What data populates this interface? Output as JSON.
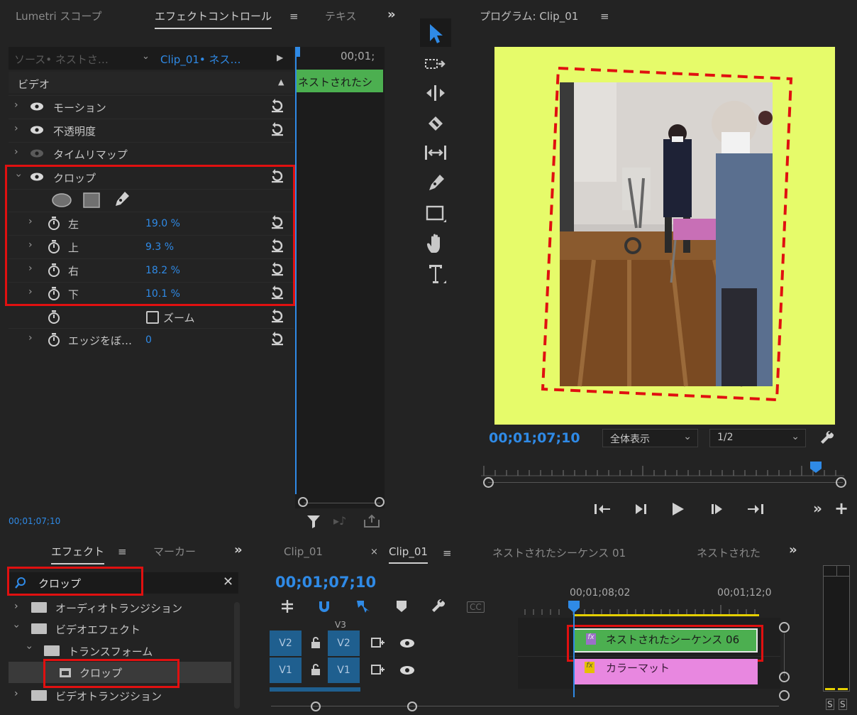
{
  "effect_controls": {
    "tabs": [
      "Lumetri スコープ",
      "エフェクトコントロール",
      "テキス"
    ],
    "source_label": "ソース• ネストさ…",
    "clip_label": "Clip_01• ネス…",
    "mini_timecode": "00;01;",
    "mini_clip": "ネストされたシ",
    "section": "ビデオ",
    "effects": [
      "モーション",
      "不透明度",
      "タイムリマップ",
      "クロップ"
    ],
    "crop_params": [
      {
        "label": "左",
        "value": "19.0 %"
      },
      {
        "label": "上",
        "value": "9.3 %"
      },
      {
        "label": "右",
        "value": "18.2 %"
      },
      {
        "label": "下",
        "value": "10.1 %"
      }
    ],
    "zoom_label": "ズーム",
    "edge_label": "エッジをぼ…",
    "edge_value": "0",
    "timecode": "00;01;07;10"
  },
  "program": {
    "title": "プログラム: Clip_01",
    "timecode": "00;01;07;10",
    "fit": "全体表示",
    "resolution": "1/2",
    "bg_color": "#e6fb6a"
  },
  "effects_panel": {
    "tabs": [
      "エフェクト",
      "マーカー"
    ],
    "search_value": "クロップ",
    "tree": [
      "オーディオトランジション",
      "ビデオエフェクト",
      "トランスフォーム",
      "クロップ",
      "ビデオトランジション"
    ]
  },
  "timeline": {
    "tabs": [
      "Clip_01",
      "Clip_01",
      "ネストされたシーケンス 01",
      "ネストされた"
    ],
    "timecode": "00;01;07;10",
    "ruler": [
      "00;01;08;02",
      "00;01;12;0"
    ],
    "tracks": [
      {
        "src": "V2",
        "dst": "V2"
      },
      {
        "src": "V1",
        "dst": "V1"
      }
    ],
    "v3": "V3",
    "clip_nested": "ネストされたシーケンス 06",
    "clip_matte": "カラーマット",
    "fx": "fx",
    "cc": "CC"
  },
  "meter": {
    "labels": [
      "S",
      "S"
    ]
  }
}
